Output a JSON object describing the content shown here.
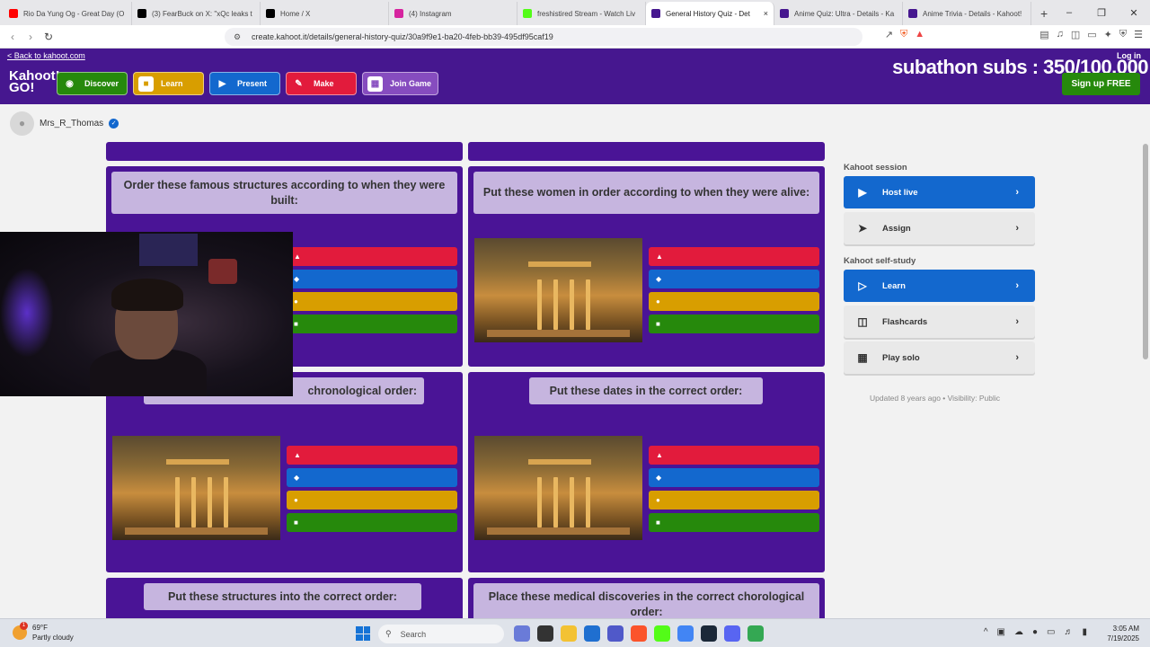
{
  "browser": {
    "tabs": [
      {
        "label": "Rio Da Yung Og - Great Day (O",
        "icon": "youtube-icon",
        "color": "#ff0000"
      },
      {
        "label": "(3) FearBuck on X: \"xQc leaks t",
        "icon": "x-icon",
        "color": "#000000"
      },
      {
        "label": "Home / X",
        "icon": "x-icon",
        "color": "#000000"
      },
      {
        "label": "(4) Instagram",
        "icon": "instagram-icon",
        "color": "#d6249f"
      },
      {
        "label": "freshistired Stream - Watch Liv",
        "icon": "kick-icon",
        "color": "#53fc18"
      },
      {
        "label": "General History Quiz - Det",
        "icon": "kahoot-icon",
        "color": "#46178f",
        "active": true
      },
      {
        "label": "Anime Quiz: Ultra - Details - Ka",
        "icon": "kahoot-icon",
        "color": "#46178f"
      },
      {
        "label": "Anime Trivia - Details - Kahoot!",
        "icon": "kahoot-icon",
        "color": "#46178f"
      }
    ],
    "new_tab": "+",
    "close_symbol": "×",
    "url": "create.kahoot.it/details/general-history-quiz/30a9f9e1-ba20-4feb-bb39-495df95caf19"
  },
  "header": {
    "back_link": "< Back to kahoot.com",
    "login": "Log in",
    "logo_line1": "Kahoot!",
    "logo_line2": "GO!",
    "nav": [
      {
        "label": "Discover",
        "color": "#26890c",
        "icon": "compass-icon"
      },
      {
        "label": "Learn",
        "color": "#d89e00",
        "icon": "graduation-cap-icon"
      },
      {
        "label": "Present",
        "color": "#1368ce",
        "icon": "play-icon"
      },
      {
        "label": "Make",
        "color": "#e21b3c",
        "icon": "pencil-icon"
      },
      {
        "label": "Join Game",
        "color": "#864cbf",
        "icon": "grid-icon"
      }
    ],
    "overlay_text": "subathon subs : 350/100,000",
    "signup": "Sign up FREE"
  },
  "user": {
    "name": "Mrs_R_Thomas",
    "verified_mark": "✓"
  },
  "questions": [
    {
      "title": "Order these famous structures according to when they were built:"
    },
    {
      "title": "Put these women in order according to when they were alive:"
    },
    {
      "title": "chronological order:"
    },
    {
      "title": "Put these dates in the correct order:"
    },
    {
      "title": "Put these structures into the correct order:"
    },
    {
      "title": "Place these medical discoveries in the correct chorological order:"
    }
  ],
  "answer_shapes": [
    "▲",
    "◆",
    "●",
    "■"
  ],
  "sidebar": {
    "session_heading": "Kahoot session",
    "host_live": "Host live",
    "assign": "Assign",
    "selfstudy_heading": "Kahoot self-study",
    "learn": "Learn",
    "flashcards": "Flashcards",
    "play_solo": "Play solo",
    "updated": "Updated 8 years ago • Visibility: Public",
    "chevron": "›"
  },
  "taskbar": {
    "temperature": "69°F",
    "weather": "Partly cloudy",
    "weather_badge": "1",
    "search": "Search",
    "time": "3:05 AM",
    "date": "7/19/2025"
  },
  "colors": {
    "kahoot_purple": "#46178f",
    "card_purple": "#4a1496",
    "answer_red": "#e21b3c",
    "answer_blue": "#1368ce",
    "answer_yellow": "#d89e00",
    "answer_green": "#26890c"
  }
}
